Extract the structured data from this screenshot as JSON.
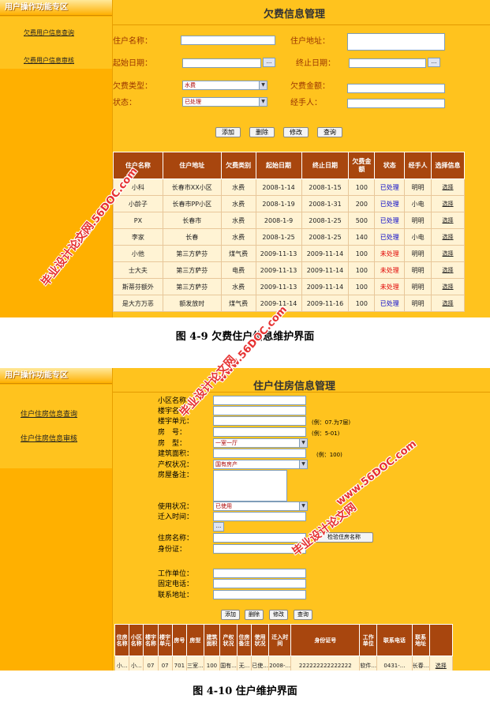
{
  "figure1": {
    "sidebar": {
      "title": "用户操作功能专区",
      "links": [
        "欠费用户信息查询",
        "欠费用户信息审核"
      ]
    },
    "page_title": "欠费信息管理",
    "form": {
      "owner_name_label": "住户名称：",
      "owner_addr_label": "住户地址：",
      "start_date_label": "起始日期：",
      "end_date_label": "终止日期：",
      "fee_type_label": "欠费类型：",
      "fee_type_value": "水费",
      "fee_amount_label": "欠费金额：",
      "status_label": "状态：",
      "status_value": "已处理",
      "handler_label": "经手人：",
      "date_btn": "..."
    },
    "buttons": [
      "添加",
      "删除",
      "修改",
      "查询"
    ],
    "table": {
      "headers": [
        "住户名称",
        "住户地址",
        "欠费类别",
        "起始日期",
        "终止日期",
        "欠费金额",
        "状态",
        "经手人",
        "选择信息"
      ],
      "rows": [
        [
          "小科",
          "长春市XX小区",
          "水费",
          "2008-1-14",
          "2008-1-15",
          "100",
          "已处理",
          "明明",
          "选择"
        ],
        [
          "小龄子",
          "长春市PP小区",
          "水费",
          "2008-1-19",
          "2008-1-31",
          "200",
          "已处理",
          "小电",
          "选择"
        ],
        [
          "PX",
          "长春市",
          "水费",
          "2008-1-9",
          "2008-1-25",
          "500",
          "已处理",
          "明明",
          "选择"
        ],
        [
          "李家",
          "长春",
          "水费",
          "2008-1-25",
          "2008-1-25",
          "140",
          "已处理",
          "小电",
          "选择"
        ],
        [
          "小他",
          "第三方萨芬",
          "煤气费",
          "2009-11-13",
          "2009-11-14",
          "100",
          "未处理",
          "明明",
          "选择"
        ],
        [
          "士大夫",
          "第三方萨芬",
          "电费",
          "2009-11-13",
          "2009-11-14",
          "100",
          "未处理",
          "明明",
          "选择"
        ],
        [
          "斯蒂芬额外",
          "第三方萨芬",
          "水费",
          "2009-11-13",
          "2009-11-14",
          "100",
          "未处理",
          "明明",
          "选择"
        ],
        [
          "是大方万恶",
          "额发放时",
          "煤气费",
          "2009-11-14",
          "2009-11-16",
          "100",
          "已处理",
          "明明",
          "选择"
        ]
      ]
    },
    "caption": "图 4-9 欠费住户信息维护界面"
  },
  "figure2": {
    "sidebar": {
      "title": "用户操作功能专区",
      "links": [
        "住户住房信息查询",
        "住户住房信息审核"
      ]
    },
    "page_title": "住户住房信息管理",
    "form": {
      "community_label": "小区名称：",
      "building_label": "楼宇名称：",
      "unit_label": "楼宇单元：",
      "unit_hint": "(例：07.为7层)",
      "room_label": "房　号：",
      "room_hint": "(例：5-01)",
      "type_label": "房　型：",
      "type_value": "一室一厅",
      "area_label": "建筑面积：",
      "area_hint": "(例：100)",
      "property_label": "产权状况：",
      "property_value": "国有房产",
      "remark_label": "房屋备注：",
      "use_label": "使用状况：",
      "use_value": "已使用",
      "move_in_label": "迁入时间：",
      "owner_label": "住房名称：",
      "check_btn": "检验住房名称",
      "id_label": "身份证：",
      "work_label": "工作单位：",
      "phone_label": "固定电话：",
      "addr_label": "联系地址：",
      "date_btn": "..."
    },
    "buttons": [
      "添加",
      "删除",
      "修改",
      "查询"
    ],
    "table": {
      "headers": [
        "住房名称",
        "小区名称",
        "楼宇名称",
        "楼宇单元",
        "房号",
        "房型",
        "建筑面积",
        "产权状况",
        "住房备注",
        "使用状况",
        "迁入时间",
        "身份证号",
        "工作单位",
        "联系电话",
        "联系地址",
        ""
      ],
      "row": [
        "小...",
        "小...",
        "07",
        "07",
        "701",
        "三室...",
        "100",
        "国有...",
        "无...",
        "已使...",
        "2008-...",
        "222222222222222",
        "软件...",
        "0431-...",
        "长春...",
        "选择"
      ]
    },
    "caption": "图 4-10 住户维护界面"
  },
  "watermark": {
    "site": "www.56DOC.com",
    "name": "毕业设计论文网"
  }
}
